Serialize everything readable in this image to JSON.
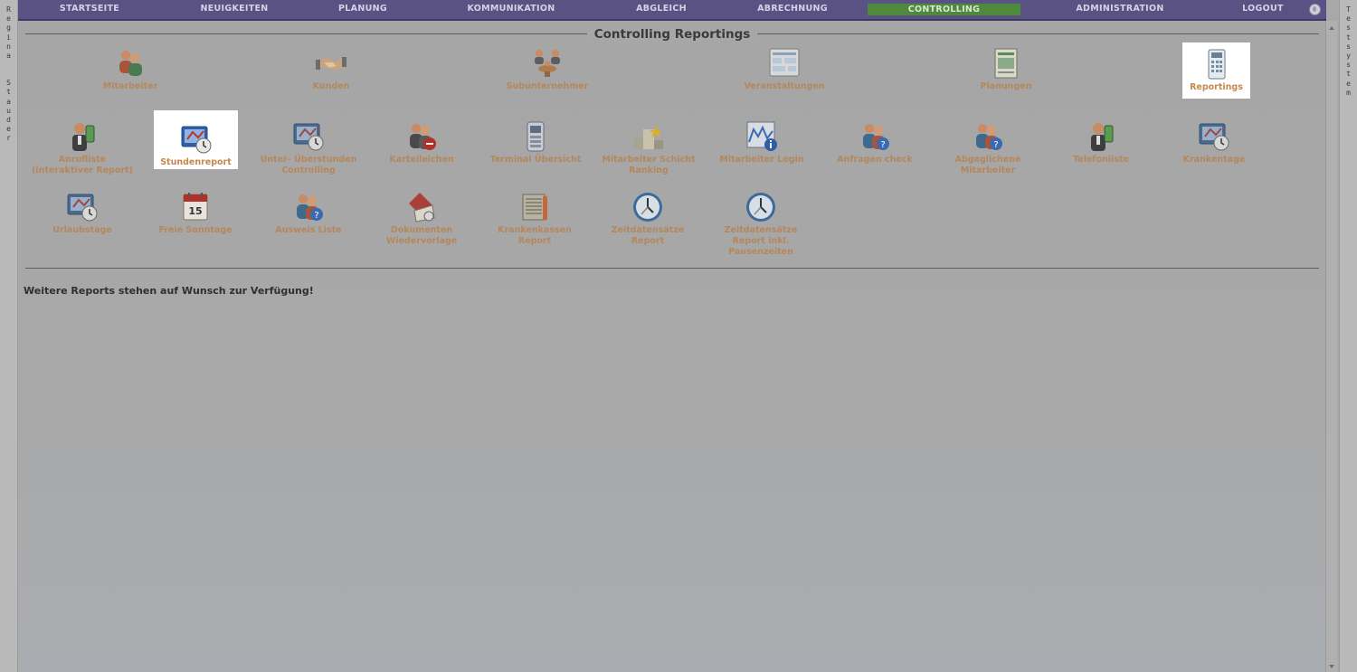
{
  "sidebar_left": {
    "text": "Regina Stauder"
  },
  "sidebar_right": {
    "text": "Testsystem"
  },
  "nav": {
    "items": [
      {
        "label": "STARTSEITE"
      },
      {
        "label": "NEUIGKEITEN"
      },
      {
        "label": "PLANUNG"
      },
      {
        "label": "KOMMUNIKATION"
      },
      {
        "label": "ABGLEICH"
      },
      {
        "label": "ABRECHNUNG"
      },
      {
        "label": "CONTROLLING",
        "active": true
      },
      {
        "label": "ADMINISTRATION"
      },
      {
        "label": "LOGOUT"
      }
    ]
  },
  "page": {
    "title": "Controlling Reportings",
    "footer_note": "Weitere Reports stehen auf Wunsch zur Verfügung!"
  },
  "top_row": [
    {
      "label": "Mitarbeiter",
      "icon": "users-icon"
    },
    {
      "label": "Kunden",
      "icon": "handshake-icon"
    },
    {
      "label": "Subunternehmer",
      "icon": "network-users-icon"
    },
    {
      "label": "Veranstaltungen",
      "icon": "schedule-board-icon"
    },
    {
      "label": "Planungen",
      "icon": "planning-document-icon"
    },
    {
      "label": "Reportings",
      "icon": "calculator-icon",
      "highlighted": true
    }
  ],
  "grid": [
    {
      "label": "Anrufliste (interaktiver Report)",
      "icon": "phone-man-icon"
    },
    {
      "label": "Stundenreport",
      "icon": "monitor-clock-icon",
      "highlighted": true
    },
    {
      "label": "Unter- Überstunden Controlling",
      "icon": "monitor-clock-icon"
    },
    {
      "label": "Karteileichen",
      "icon": "users-blocked-icon"
    },
    {
      "label": "Terminal Übersicht",
      "icon": "terminal-icon"
    },
    {
      "label": "Mitarbeiter Schicht Ranking",
      "icon": "ranking-star-icon"
    },
    {
      "label": "Mitarbeiter Login",
      "icon": "chart-info-icon"
    },
    {
      "label": "Anfragen check",
      "icon": "users-question-icon"
    },
    {
      "label": "Abgeglichene Mitarbeiter",
      "icon": "users-question-icon"
    },
    {
      "label": "Telefonliste",
      "icon": "phone-man-icon"
    },
    {
      "label": "Krankentage",
      "icon": "monitor-clock-icon"
    },
    {
      "label": "Urlaubstage",
      "icon": "monitor-clock-icon"
    },
    {
      "label": "Freie Sonntage",
      "icon": "calendar-15-icon"
    },
    {
      "label": "Ausweis Liste",
      "icon": "users-question-icon"
    },
    {
      "label": "Dokumenten Wiedervorlage",
      "icon": "document-stack-icon"
    },
    {
      "label": "Krankenkassen Report",
      "icon": "book-stack-icon"
    },
    {
      "label": "Zeitdatensätze Report",
      "icon": "clock-icon"
    },
    {
      "label": "Zeitdatensätze Report inkl. Pausenzeiten",
      "icon": "clock-icon"
    }
  ]
}
